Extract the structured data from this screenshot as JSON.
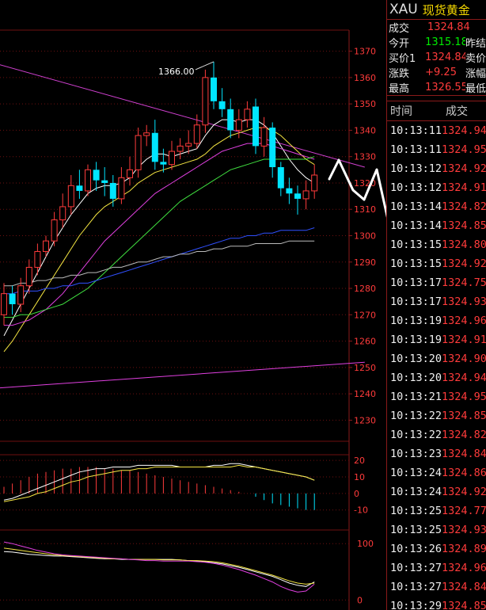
{
  "chart_data": [
    {
      "type": "candlestick",
      "ylim": [
        1222,
        1378
      ],
      "y_ticks": [
        "1370",
        "1360",
        "1350",
        "1340",
        "1330",
        "1320",
        "1310",
        "1300",
        "1290",
        "1280",
        "1270",
        "1260",
        "1250",
        "1240",
        "1230"
      ],
      "annotation": "1366.00",
      "candles": [
        {
          "o": 1270,
          "c": 1278,
          "h": 1282,
          "l": 1266
        },
        {
          "o": 1278,
          "c": 1274,
          "h": 1281,
          "l": 1270
        },
        {
          "o": 1274,
          "c": 1281,
          "h": 1284,
          "l": 1271
        },
        {
          "o": 1281,
          "c": 1288,
          "h": 1291,
          "l": 1278
        },
        {
          "o": 1288,
          "c": 1294,
          "h": 1297,
          "l": 1285
        },
        {
          "o": 1294,
          "c": 1298,
          "h": 1300,
          "l": 1292
        },
        {
          "o": 1298,
          "c": 1306,
          "h": 1309,
          "l": 1296
        },
        {
          "o": 1306,
          "c": 1311,
          "h": 1316,
          "l": 1303
        },
        {
          "o": 1311,
          "c": 1319,
          "h": 1323,
          "l": 1308
        },
        {
          "o": 1319,
          "c": 1317,
          "h": 1325,
          "l": 1314
        },
        {
          "o": 1317,
          "c": 1325,
          "h": 1327,
          "l": 1315
        },
        {
          "o": 1325,
          "c": 1321,
          "h": 1328,
          "l": 1317
        },
        {
          "o": 1321,
          "c": 1320,
          "h": 1326,
          "l": 1315
        },
        {
          "o": 1320,
          "c": 1314,
          "h": 1323,
          "l": 1311
        },
        {
          "o": 1314,
          "c": 1322,
          "h": 1326,
          "l": 1312
        },
        {
          "o": 1322,
          "c": 1325,
          "h": 1330,
          "l": 1319
        },
        {
          "o": 1325,
          "c": 1338,
          "h": 1341,
          "l": 1322
        },
        {
          "o": 1338,
          "c": 1339,
          "h": 1342,
          "l": 1334
        },
        {
          "o": 1339,
          "c": 1328,
          "h": 1344,
          "l": 1325
        },
        {
          "o": 1328,
          "c": 1327,
          "h": 1333,
          "l": 1324
        },
        {
          "o": 1327,
          "c": 1332,
          "h": 1336,
          "l": 1325
        },
        {
          "o": 1332,
          "c": 1334,
          "h": 1337,
          "l": 1329
        },
        {
          "o": 1334,
          "c": 1335,
          "h": 1340,
          "l": 1331
        },
        {
          "o": 1335,
          "c": 1342,
          "h": 1346,
          "l": 1333
        },
        {
          "o": 1342,
          "c": 1360,
          "h": 1363,
          "l": 1339
        },
        {
          "o": 1360,
          "c": 1351,
          "h": 1366,
          "l": 1348
        },
        {
          "o": 1351,
          "c": 1348,
          "h": 1356,
          "l": 1345
        },
        {
          "o": 1348,
          "c": 1340,
          "h": 1352,
          "l": 1337
        },
        {
          "o": 1340,
          "c": 1344,
          "h": 1348,
          "l": 1337
        },
        {
          "o": 1344,
          "c": 1348,
          "h": 1351,
          "l": 1341
        },
        {
          "o": 1349,
          "c": 1334,
          "h": 1352,
          "l": 1331
        },
        {
          "o": 1334,
          "c": 1341,
          "h": 1345,
          "l": 1330
        },
        {
          "o": 1341,
          "c": 1326,
          "h": 1343,
          "l": 1322
        },
        {
          "o": 1326,
          "c": 1318,
          "h": 1328,
          "l": 1315
        },
        {
          "o": 1318,
          "c": 1316,
          "h": 1322,
          "l": 1312
        },
        {
          "o": 1316,
          "c": 1314,
          "h": 1319,
          "l": 1308
        },
        {
          "o": 1314,
          "c": 1317,
          "h": 1321,
          "l": 1310
        },
        {
          "o": 1317,
          "c": 1323,
          "h": 1327,
          "l": 1314
        }
      ],
      "ma_lines": [
        {
          "color": "#ffffff",
          "values": [
            1262,
            1268,
            1274,
            1280,
            1286,
            1292,
            1298,
            1303,
            1308,
            1312,
            1316,
            1318,
            1319,
            1319,
            1320,
            1322,
            1326,
            1329,
            1331,
            1331,
            1330,
            1331,
            1332,
            1333,
            1338,
            1342,
            1344,
            1344,
            1343,
            1344,
            1344,
            1342,
            1339,
            1334,
            1329,
            1325,
            1322,
            1320
          ]
        },
        {
          "color": "#f5e642",
          "values": [
            1256,
            1260,
            1265,
            1270,
            1275,
            1280,
            1285,
            1290,
            1295,
            1300,
            1304,
            1308,
            1311,
            1313,
            1315,
            1317,
            1320,
            1322,
            1324,
            1325,
            1326,
            1327,
            1328,
            1329,
            1331,
            1334,
            1336,
            1338,
            1339,
            1340,
            1341,
            1341,
            1340,
            1338,
            1335,
            1332,
            1329,
            1327
          ]
        },
        {
          "color": "#e040e0",
          "values": [
            1266,
            1266,
            1267,
            1268,
            1270,
            1272,
            1275,
            1278,
            1282,
            1286,
            1290,
            1294,
            1298,
            1301,
            1304,
            1307,
            1310,
            1313,
            1316,
            1318,
            1320,
            1322,
            1324,
            1326,
            1328,
            1330,
            1332,
            1333,
            1334,
            1335,
            1335,
            1335,
            1334,
            1333,
            1332,
            1331,
            1330,
            1329
          ]
        },
        {
          "color": "#40e040",
          "values": [
            1269,
            1269,
            1270,
            1270,
            1271,
            1272,
            1273,
            1274,
            1276,
            1278,
            1280,
            1283,
            1286,
            1289,
            1292,
            1295,
            1298,
            1301,
            1304,
            1307,
            1310,
            1313,
            1315,
            1317,
            1319,
            1321,
            1323,
            1325,
            1326,
            1327,
            1328,
            1329,
            1329,
            1329,
            1329,
            1329,
            1329,
            1330
          ]
        },
        {
          "color": "#3050ff",
          "values": [
            1278,
            1278,
            1279,
            1279,
            1279,
            1280,
            1280,
            1281,
            1281,
            1282,
            1282,
            1283,
            1284,
            1285,
            1286,
            1287,
            1288,
            1289,
            1290,
            1291,
            1292,
            1293,
            1294,
            1295,
            1296,
            1297,
            1298,
            1299,
            1299,
            1300,
            1300,
            1301,
            1301,
            1302,
            1302,
            1302,
            1302,
            1303
          ]
        },
        {
          "color": "#bbbbbb",
          "values": [
            1281,
            1281,
            1282,
            1282,
            1283,
            1283,
            1284,
            1284,
            1285,
            1285,
            1286,
            1286,
            1287,
            1288,
            1288,
            1289,
            1290,
            1290,
            1291,
            1292,
            1292,
            1293,
            1293,
            1294,
            1294,
            1295,
            1295,
            1296,
            1296,
            1296,
            1297,
            1297,
            1297,
            1297,
            1298,
            1298,
            1298,
            1298
          ]
        }
      ],
      "trend_lines": [
        {
          "color": "#d040d0",
          "from": [
            -4,
            1368
          ],
          "to": [
            43,
            1326
          ]
        },
        {
          "color": "#e040e0",
          "from": [
            -6,
            1241
          ],
          "to": [
            43,
            1252
          ]
        }
      ]
    },
    {
      "type": "bar",
      "ylim": [
        -13,
        22
      ],
      "y_ticks": [
        "20",
        "10",
        "0",
        "-10"
      ],
      "bars": [
        4,
        6,
        8,
        10,
        12,
        13,
        14,
        15,
        15,
        16,
        16,
        16,
        15,
        15,
        14,
        14,
        13,
        12,
        11,
        10,
        9,
        8,
        7,
        6,
        5,
        4,
        3,
        2,
        1,
        0,
        -2,
        -4,
        -6,
        -7,
        -8,
        -9,
        -10,
        -10
      ],
      "lines": [
        {
          "color": "#ffffff",
          "values": [
            -4,
            -3,
            -1,
            1,
            3,
            5,
            7,
            9,
            11,
            13,
            14,
            15,
            15,
            16,
            16,
            16,
            17,
            17,
            17,
            17,
            17,
            16,
            16,
            16,
            16,
            17,
            17,
            18,
            18,
            17,
            16,
            15,
            14,
            13,
            12,
            11,
            10,
            8
          ]
        },
        {
          "color": "#f5e642",
          "values": [
            -5,
            -4,
            -3,
            -2,
            0,
            1,
            3,
            5,
            7,
            8,
            10,
            11,
            12,
            13,
            14,
            14,
            15,
            15,
            16,
            16,
            16,
            16,
            16,
            16,
            16,
            16,
            16,
            16,
            17,
            16,
            16,
            15,
            14,
            13,
            12,
            11,
            10,
            8
          ]
        }
      ]
    },
    {
      "type": "line",
      "ylim": [
        -15,
        120
      ],
      "y_ticks": [
        "100",
        "0"
      ],
      "lines": [
        {
          "color": "#ffffff",
          "values": [
            86,
            85,
            83,
            81,
            80,
            79,
            78,
            78,
            77,
            76,
            75,
            74,
            73,
            73,
            72,
            72,
            72,
            72,
            72,
            72,
            72,
            71,
            70,
            69,
            68,
            66,
            64,
            61,
            58,
            54,
            50,
            46,
            42,
            36,
            30,
            26,
            24,
            32
          ]
        },
        {
          "color": "#f5e642",
          "values": [
            92,
            90,
            88,
            86,
            84,
            82,
            80,
            79,
            78,
            77,
            76,
            75,
            74,
            73,
            73,
            72,
            72,
            72,
            72,
            71,
            71,
            71,
            70,
            70,
            69,
            68,
            66,
            63,
            60,
            56,
            52,
            48,
            44,
            39,
            34,
            30,
            28,
            30
          ]
        },
        {
          "color": "#e040e0",
          "values": [
            103,
            100,
            96,
            92,
            88,
            85,
            82,
            80,
            79,
            78,
            77,
            76,
            75,
            74,
            73,
            72,
            71,
            70,
            70,
            69,
            69,
            69,
            69,
            68,
            67,
            65,
            62,
            58,
            54,
            49,
            44,
            38,
            32,
            24,
            18,
            14,
            16,
            28
          ]
        }
      ]
    }
  ],
  "header": {
    "symbol": "XAU",
    "name": "现货黄金"
  },
  "quote": {
    "row1": {
      "label": "成交",
      "value": "1324.84"
    },
    "row2": {
      "label": "今开",
      "value": "1315.18",
      "extra": "昨结"
    },
    "row3": {
      "label": "买价1",
      "value": "1324.84",
      "extra": "卖价"
    },
    "row4": {
      "label": "涨跌",
      "value": "+9.25",
      "extra": "涨幅"
    },
    "row5": {
      "label": "最高",
      "value": "1326.55",
      "extra": "最低"
    }
  },
  "ticks_header": {
    "time": "时间",
    "price": "成交"
  },
  "ticks": [
    {
      "time": "10:13:11",
      "price": "1324.94"
    },
    {
      "time": "10:13:11",
      "price": "1324.95"
    },
    {
      "time": "10:13:12",
      "price": "1324.92"
    },
    {
      "time": "10:13:12",
      "price": "1324.91"
    },
    {
      "time": "10:13:14",
      "price": "1324.82"
    },
    {
      "time": "10:13:14",
      "price": "1324.85"
    },
    {
      "time": "10:13:15",
      "price": "1324.80"
    },
    {
      "time": "10:13:15",
      "price": "1324.92"
    },
    {
      "time": "10:13:17",
      "price": "1324.75"
    },
    {
      "time": "10:13:17",
      "price": "1324.93"
    },
    {
      "time": "10:13:19",
      "price": "1324.96"
    },
    {
      "time": "10:13:19",
      "price": "1324.91"
    },
    {
      "time": "10:13:20",
      "price": "1324.90"
    },
    {
      "time": "10:13:20",
      "price": "1324.94"
    },
    {
      "time": "10:13:21",
      "price": "1324.95"
    },
    {
      "time": "10:13:22",
      "price": "1324.85"
    },
    {
      "time": "10:13:22",
      "price": "1324.82"
    },
    {
      "time": "10:13:23",
      "price": "1324.84"
    },
    {
      "time": "10:13:24",
      "price": "1324.86"
    },
    {
      "time": "10:13:24",
      "price": "1324.92"
    },
    {
      "time": "10:13:25",
      "price": "1324.77"
    },
    {
      "time": "10:13:25",
      "price": "1324.93"
    },
    {
      "time": "10:13:26",
      "price": "1324.89"
    },
    {
      "time": "10:13:27",
      "price": "1324.96"
    },
    {
      "time": "10:13:27",
      "price": "1324.84"
    },
    {
      "time": "10:13:29",
      "price": "1324.85"
    }
  ]
}
